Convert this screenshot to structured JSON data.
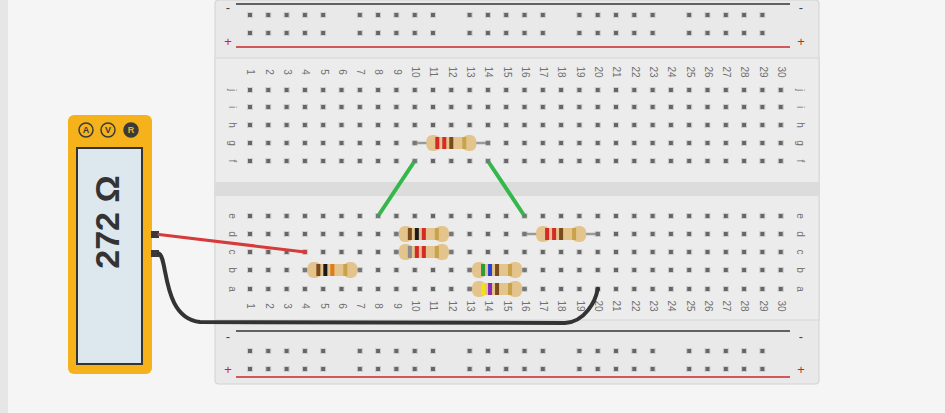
{
  "meter": {
    "reading": "272 Ω",
    "modes": [
      {
        "label": "A",
        "selected": false
      },
      {
        "label": "V",
        "selected": false
      },
      {
        "label": "R",
        "selected": true
      }
    ]
  },
  "breadboard": {
    "columns": [
      "1",
      "2",
      "3",
      "4",
      "5",
      "6",
      "7",
      "8",
      "9",
      "10",
      "11",
      "12",
      "13",
      "14",
      "15",
      "16",
      "17",
      "18",
      "19",
      "20",
      "21",
      "22",
      "23",
      "24",
      "25",
      "26",
      "27",
      "28",
      "29",
      "30"
    ],
    "rows_top": [
      "j",
      "i",
      "h",
      "g",
      "f"
    ],
    "rows_bottom": [
      "e",
      "d",
      "c",
      "b",
      "a"
    ],
    "rail_minus": "-",
    "rail_plus": "+"
  },
  "resistors": [
    {
      "from": "g10",
      "to": "g14",
      "bands": [
        "#d62a2a",
        "#d62a2a",
        "#7a4a1e",
        "#c9a24a"
      ]
    },
    {
      "from": "d9",
      "to": "d12",
      "bands": [
        "#7a4a1e",
        "#1a1a1a",
        "#d62a2a",
        "#c9a24a"
      ]
    },
    {
      "from": "c9",
      "to": "c12",
      "bands": [
        "#8c8c8c",
        "#d62a2a",
        "#d62a2a",
        "#c9a24a"
      ]
    },
    {
      "from": "d16",
      "to": "d20",
      "bands": [
        "#d62a2a",
        "#d62a2a",
        "#7a4a1e",
        "#c9a24a"
      ]
    },
    {
      "from": "b4",
      "to": "b7",
      "bands": [
        "#7a4a1e",
        "#1a1a1a",
        "#e07b1a",
        "#c9a24a"
      ]
    },
    {
      "from": "b13",
      "to": "b16",
      "bands": [
        "#2a9d3a",
        "#2a3fd6",
        "#7a4a1e",
        "#c9a24a"
      ]
    },
    {
      "from": "a13",
      "to": "a16",
      "bands": [
        "#f2e11a",
        "#8a2ab0",
        "#7a4a1e",
        "#c9a24a"
      ]
    }
  ],
  "wires": [
    {
      "from": "f10",
      "to": "e8",
      "color": "#34b84c"
    },
    {
      "from": "f14",
      "to": "e16",
      "color": "#34b84c"
    }
  ],
  "probes": [
    {
      "to": "c4",
      "color": "#d63a3a"
    },
    {
      "to": "a20",
      "color": "#333333"
    }
  ]
}
